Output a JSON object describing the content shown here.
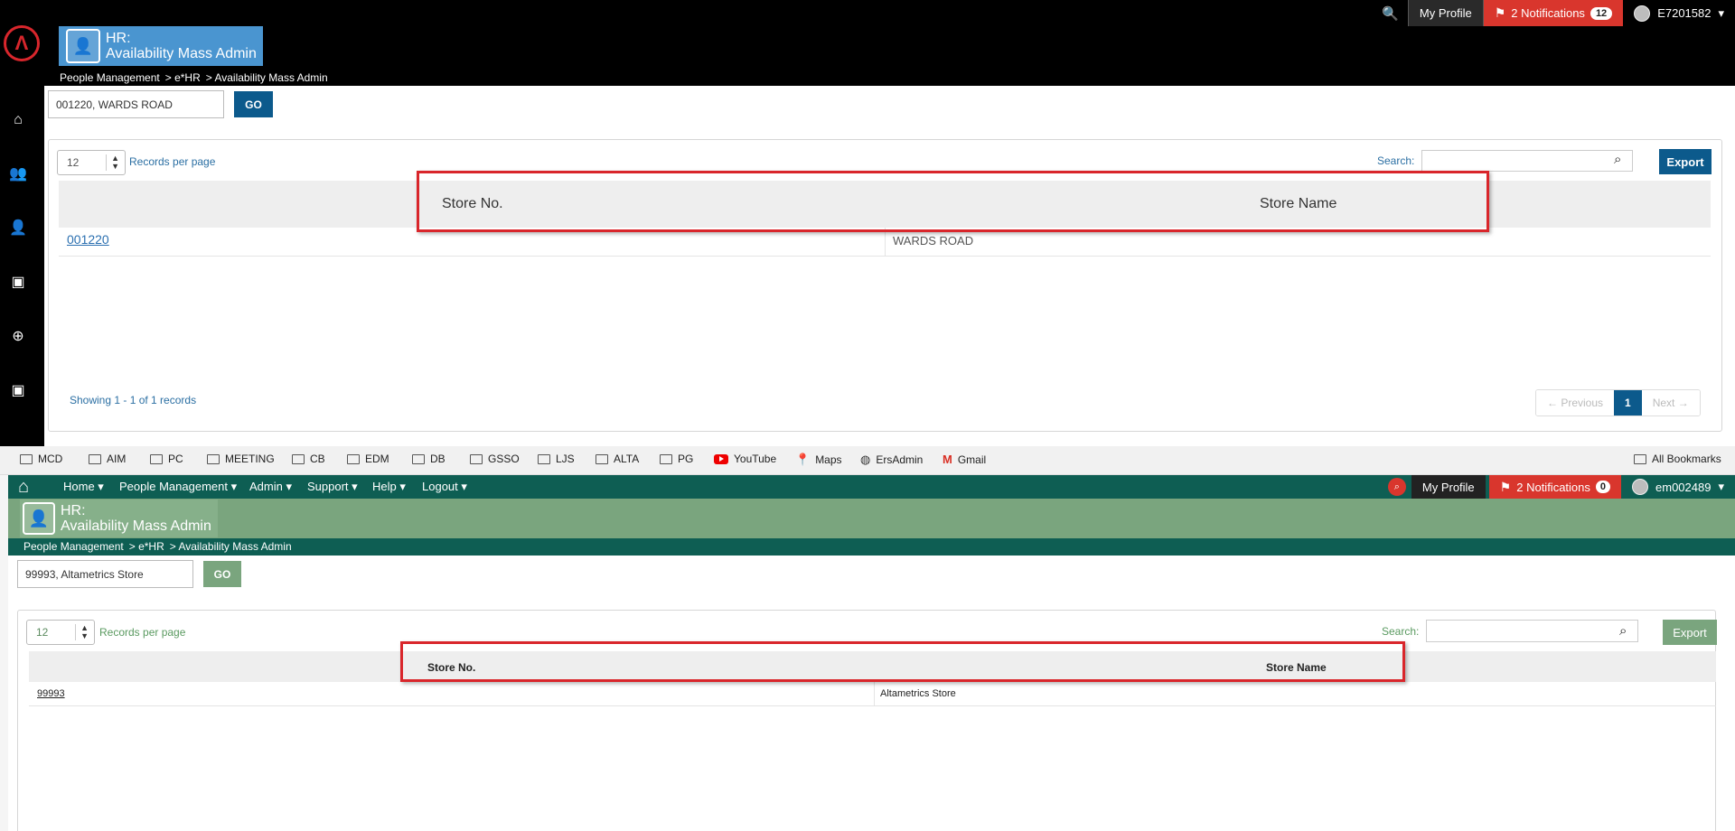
{
  "top": {
    "topbar": {
      "my_profile": "My Profile",
      "notifications": "2 Notifications",
      "notif_count": "12",
      "user": "E7201582"
    },
    "app": {
      "title_line1": "HR:",
      "title_line2": "Availability Mass Admin"
    },
    "breadcrumb": [
      "People Management",
      "> e*HR",
      "> Availability Mass Admin"
    ],
    "store_input_value": "001220, WARDS ROAD",
    "go_label": "GO",
    "records_per_page_value": "12",
    "records_per_page_label": "Records per page",
    "search_label": "Search:",
    "export_label": "Export",
    "table": {
      "headers": [
        "Store No.",
        "Store Name"
      ],
      "rows": [
        [
          "001220",
          "WARDS ROAD"
        ]
      ]
    },
    "showing": "Showing 1 - 1 of 1 records",
    "pager": {
      "previous": "← Previous",
      "current": "1",
      "next": "Next →"
    },
    "colors": {
      "header_bg": "#000000",
      "accent": "#0c5a8c",
      "app_tile": "#4a95d0",
      "notif": "#d9362d"
    }
  },
  "bookmarks": [
    {
      "icon": "folder-icon",
      "label": "MCD"
    },
    {
      "icon": "folder-icon",
      "label": "AIM"
    },
    {
      "icon": "folder-icon",
      "label": "PC"
    },
    {
      "icon": "folder-icon",
      "label": "MEETING"
    },
    {
      "icon": "folder-icon",
      "label": "CB"
    },
    {
      "icon": "folder-icon",
      "label": "EDM"
    },
    {
      "icon": "folder-icon",
      "label": "DB"
    },
    {
      "icon": "folder-icon",
      "label": "GSSO"
    },
    {
      "icon": "folder-icon",
      "label": "LJS"
    },
    {
      "icon": "folder-icon",
      "label": "ALTA"
    },
    {
      "icon": "folder-icon",
      "label": "PG"
    },
    {
      "icon": "youtube-icon",
      "label": "YouTube"
    },
    {
      "icon": "maps-icon",
      "label": "Maps"
    },
    {
      "icon": "globe-icon",
      "label": "ErsAdmin"
    },
    {
      "icon": "gmail-icon",
      "label": "Gmail"
    }
  ],
  "all_bookmarks": "All Bookmarks",
  "bottom": {
    "nav": [
      "Home",
      "People Management",
      "Admin",
      "Support",
      "Help",
      "Logout"
    ],
    "topbar": {
      "my_profile": "My Profile",
      "notifications": "2 Notifications",
      "notif_count": "0",
      "user": "em002489"
    },
    "app": {
      "title_line1": "HR:",
      "title_line2": "Availability Mass Admin"
    },
    "breadcrumb": [
      "People Management",
      "> e*HR",
      "> Availability Mass Admin"
    ],
    "store_input_value": "99993, Altametrics Store",
    "go_label": "GO",
    "records_per_page_value": "12",
    "records_per_page_label": "Records per page",
    "search_label": "Search:",
    "export_label": "Export",
    "table": {
      "headers": [
        "Store No.",
        "Store Name"
      ],
      "rows": [
        [
          "99993",
          "Altametrics Store"
        ]
      ]
    },
    "colors": {
      "nav_bg": "#0e5e53",
      "accent": "#7aa57e",
      "notif": "#d9362d"
    }
  }
}
